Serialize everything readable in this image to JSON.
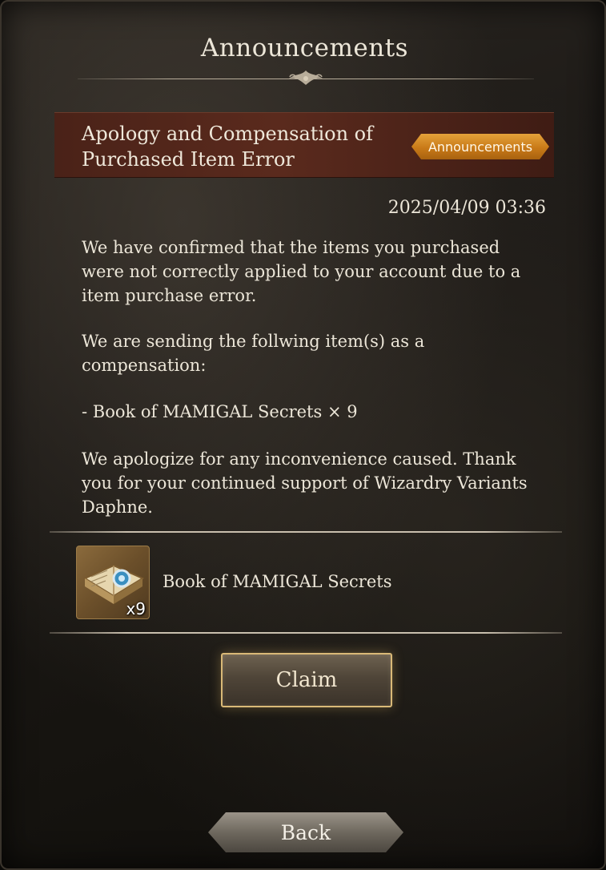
{
  "dialog": {
    "title": "Announcements"
  },
  "article": {
    "title_line1": "Apology and Compensation of",
    "title_line2": "Purchased Item Error",
    "category_tag": "Announcements",
    "date": "2025/04/09 03:36",
    "paragraphs": [
      "We have confirmed that the items you purchased were not correctly applied to your account due to a item purchase error.",
      "We are sending the follwing item(s) as a compensation:",
      "- Book of MAMIGAL Secrets × 9",
      "We apologize for any inconvenience caused. Thank you for your continued support of Wizardry Variants Daphne."
    ]
  },
  "reward": {
    "item_name": "Book of MAMIGAL Secrets",
    "quantity": "x9",
    "icon": "spellbook-icon"
  },
  "buttons": {
    "claim": "Claim",
    "back": "Back"
  },
  "colors": {
    "header_band": "#4a2218",
    "tag_orange": "#c97a18",
    "text": "#ece6d8",
    "claim_border": "#d9b977"
  }
}
